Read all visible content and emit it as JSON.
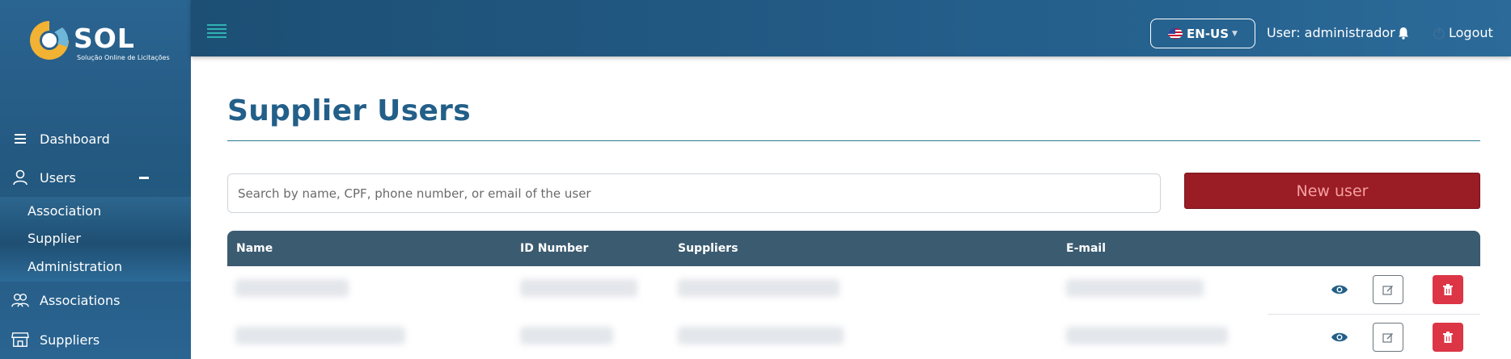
{
  "app": {
    "logo_name": "SOL",
    "logo_subtitle": "Solução Online de Licitações"
  },
  "sidebar": {
    "items": [
      {
        "label": "Dashboard",
        "icon": "menu-lines-icon"
      },
      {
        "label": "Users",
        "icon": "user-icon",
        "expanded": true
      },
      {
        "label": "Associations",
        "icon": "users-group-icon"
      },
      {
        "label": "Suppliers",
        "icon": "store-icon"
      }
    ],
    "submenu": [
      {
        "label": "Association"
      },
      {
        "label": "Supplier"
      },
      {
        "label": "Administration"
      }
    ]
  },
  "topbar": {
    "language": "EN-US",
    "user_label": "User: administrador",
    "logout_label": "Logout"
  },
  "main": {
    "title": "Supplier Users",
    "search_placeholder": "Search by name, CPF, phone number, or email of the user",
    "new_user_label": "New user",
    "table": {
      "columns": [
        "Name",
        "ID Number",
        "Suppliers",
        "E-mail"
      ],
      "row_count": 2
    }
  },
  "colors": {
    "sidebar": "#23587f",
    "title": "#225f89",
    "new_user_bg": "#9a1c24",
    "table_header": "#3b5b70",
    "delete": "#dc3545",
    "accent": "#2fb3b3"
  }
}
